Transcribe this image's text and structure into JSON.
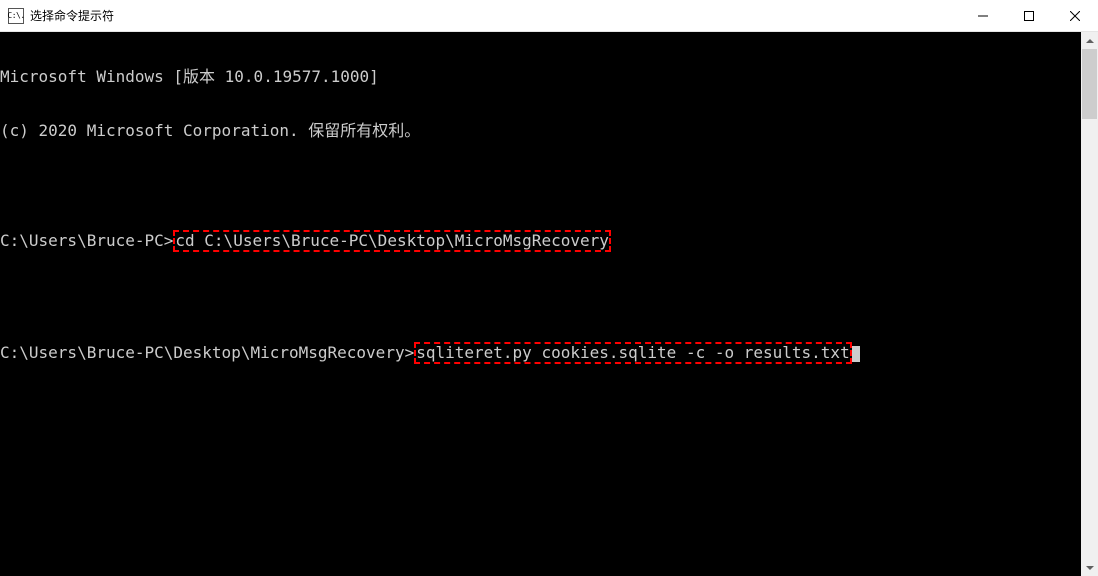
{
  "titlebar": {
    "icon_label": "C:\\.",
    "title": "选择命令提示符"
  },
  "terminal": {
    "line1": "Microsoft Windows [版本 10.0.19577.1000]",
    "line2": "(c) 2020 Microsoft Corporation. 保留所有权利。",
    "prompt1": "C:\\Users\\Bruce-PC>",
    "cmd1": "cd C:\\Users\\Bruce-PC\\Desktop\\MicroMsgRecovery",
    "prompt2": "C:\\Users\\Bruce-PC\\Desktop\\MicroMsgRecovery>",
    "cmd2": "sqliteret.py cookies.sqlite -c -o results.txt"
  }
}
